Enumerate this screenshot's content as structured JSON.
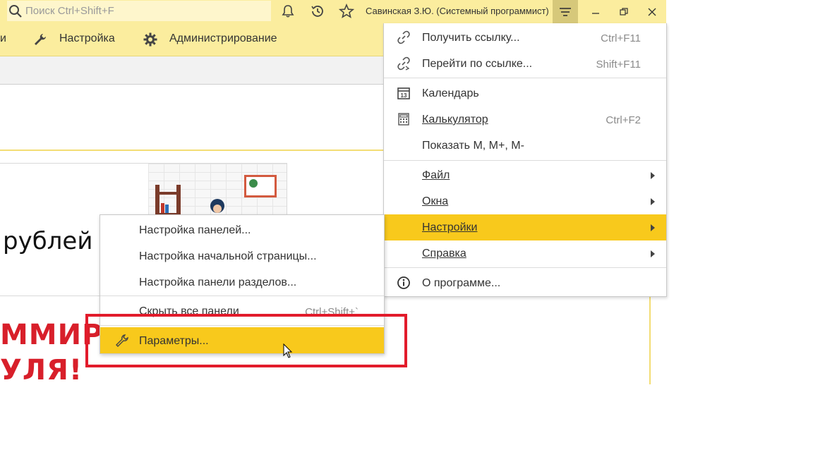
{
  "topbar": {
    "search_placeholder": "Поиск Ctrl+Shift+F",
    "user": "Савинская З.Ю. (Системный программист)",
    "icons": [
      "search-icon",
      "bell-icon",
      "history-icon",
      "star-icon",
      "hamburger-menu-icon",
      "minimize-icon",
      "restore-icon",
      "close-icon"
    ]
  },
  "sections": {
    "partial_left": "и",
    "settings": "Настройка",
    "admin": "Администрирование"
  },
  "banner": {
    "text": "рублей"
  },
  "red_text": {
    "line1": "ММИРО",
    "line2": "УЛЯ!"
  },
  "main_menu": {
    "items": [
      {
        "label": "Получить ссылку...",
        "shortcut": "Ctrl+F11",
        "icon": "link-icon"
      },
      {
        "label": "Перейти по ссылке...",
        "shortcut": "Shift+F11",
        "icon": "goto-link-icon"
      },
      {
        "label": "Календарь",
        "shortcut": "",
        "icon": "calendar-icon",
        "icon_text": "13"
      },
      {
        "label": "Калькулятор",
        "shortcut": "Ctrl+F2",
        "icon": "calculator-icon"
      },
      {
        "label": "Показать М, М+, М-",
        "shortcut": ""
      },
      {
        "label": "Файл",
        "submenu": true
      },
      {
        "label": "Окна",
        "submenu": true
      },
      {
        "label": "Настройки",
        "submenu": true,
        "active": true
      },
      {
        "label": "Справка",
        "submenu": true
      },
      {
        "label": "О программе...",
        "icon": "info-icon"
      }
    ]
  },
  "settings_submenu": {
    "items": [
      {
        "label": "Настройка панелей..."
      },
      {
        "label": "Настройка начальной страницы..."
      },
      {
        "label": "Настройка панели разделов..."
      },
      {
        "label": "Скрыть все панели",
        "shortcut": "Ctrl+Shift+`"
      },
      {
        "label": "Параметры...",
        "icon": "wrench-icon",
        "active": true
      }
    ]
  },
  "colors": {
    "topbar": "#fbed9e",
    "accent": "#f8c91c",
    "highlight_frame": "#e21b2b"
  }
}
